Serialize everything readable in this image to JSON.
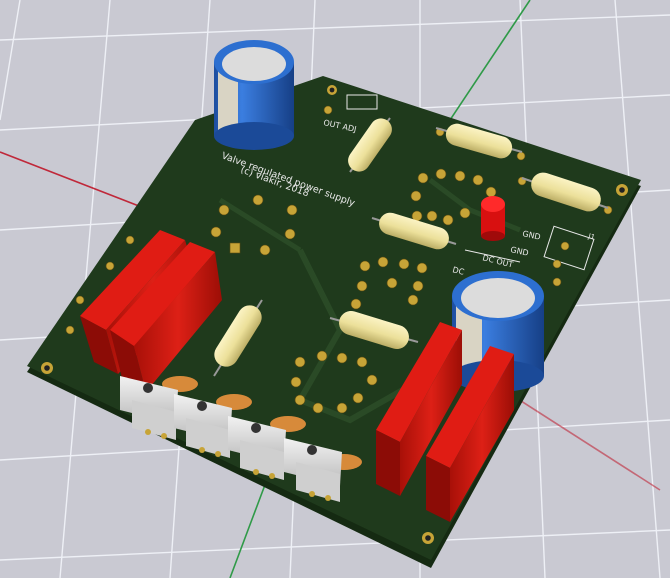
{
  "board": {
    "title_line1": "Valve regulated power supply",
    "title_line2": "(c) vlakir, 2018",
    "labels": {
      "out_adj": "OUT ADJ",
      "gnd1": "GND",
      "gnd2": "GND",
      "dc": "DC",
      "dc_out": "DC OUT",
      "j1": "J1"
    }
  },
  "colors": {
    "background": "#c9c9d2",
    "grid": "#eef0f6",
    "axis_red": "#c0283a",
    "axis_green": "#2f9a48",
    "axis_blue": "#3a4fc0",
    "board": "#1f3a1c",
    "board_edge": "#152a12",
    "pad": "#c7a437",
    "silkscreen": "#e8e8e8",
    "resistor": "#efe4a6",
    "capacitor_blue": "#2a66c4",
    "heatsink_red": "#c81610",
    "led_red": "#e01010"
  },
  "icons": [
    "capacitor-icon",
    "resistor-icon",
    "heatsink-icon",
    "transistor-icon",
    "led-icon",
    "valve-socket-icon"
  ]
}
